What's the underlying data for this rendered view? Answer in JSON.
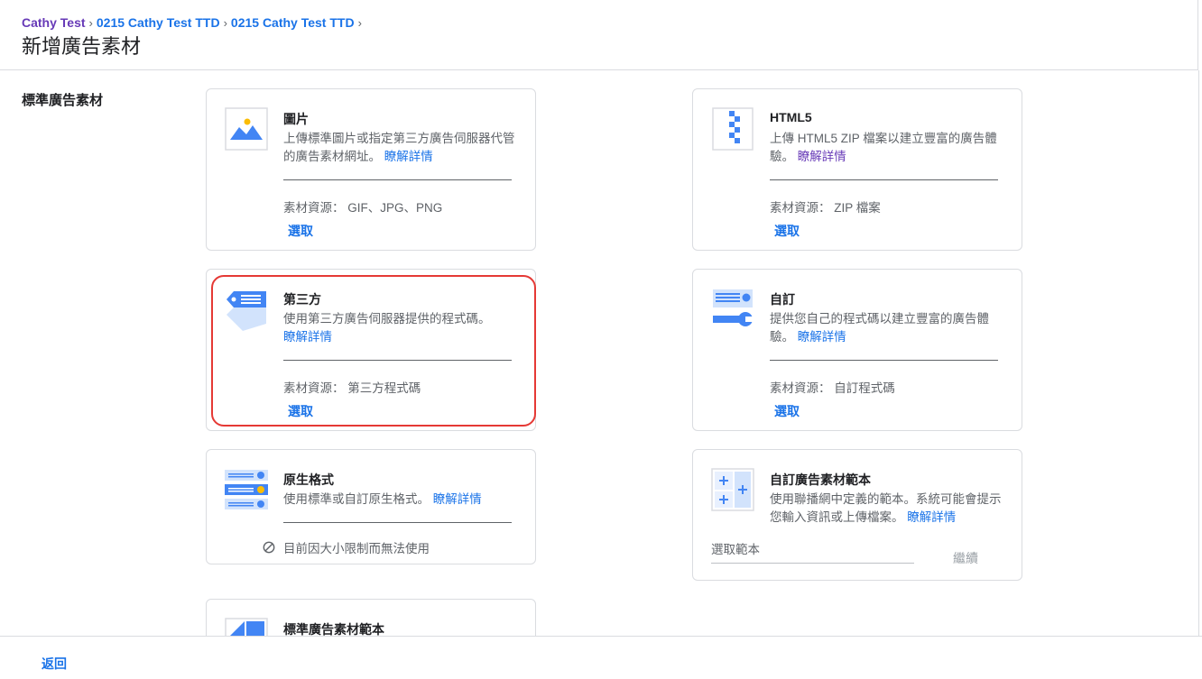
{
  "breadcrumb": {
    "items": [
      "Cathy Test",
      "0215 Cathy Test TTD",
      "0215 Cathy Test TTD"
    ],
    "separator": ">"
  },
  "page_title": "新增廣告素材",
  "section_label": "標準廣告素材",
  "cards": {
    "image": {
      "icon": "image-icon",
      "title": "圖片",
      "desc": "上傳標準圖片或指定第三方廣告伺服器代管的廣告素材網址。",
      "learn_more": "瞭解詳情",
      "source_label": "素材資源：",
      "source_value": "GIF、JPG、PNG",
      "select": "選取"
    },
    "html5": {
      "icon": "zip-file-icon",
      "title": "HTML5",
      "desc": "上傳 HTML5 ZIP 檔案以建立豐富的廣告體驗。",
      "learn_more": "瞭解詳情",
      "source_label": "素材資源：",
      "source_value": "ZIP 檔案",
      "select": "選取"
    },
    "third_party": {
      "icon": "tag-icon",
      "title": "第三方",
      "desc": "使用第三方廣告伺服器提供的程式碼。",
      "learn_more": "瞭解詳情",
      "source_label": "素材資源：",
      "source_value": "第三方程式碼",
      "select": "選取"
    },
    "custom": {
      "icon": "wrench-icon",
      "title": "自訂",
      "desc": "提供您自己的程式碼以建立豐富的廣告體驗。",
      "learn_more": "瞭解詳情",
      "source_label": "素材資源：",
      "source_value": "自訂程式碼",
      "select": "選取"
    },
    "native": {
      "icon": "native-list-icon",
      "title": "原生格式",
      "desc": "使用標準或自訂原生格式。",
      "learn_more": "瞭解詳情",
      "note": "目前因大小限制而無法使用"
    },
    "custom_template": {
      "icon": "template-plus-icon",
      "title": "自訂廣告素材範本",
      "desc": "使用聯播網中定義的範本。系統可能會提示您輸入資訊或上傳檔案。",
      "learn_more": "瞭解詳情",
      "input_placeholder": "選取範本",
      "continue": "繼續"
    },
    "standard_template": {
      "icon": "standard-template-icon",
      "title": "標準廣告素材範本"
    }
  },
  "footer": {
    "back": "返回"
  },
  "colors": {
    "link": "#1a73e8",
    "highlight": "#e53935",
    "icon_blue": "#4285f4",
    "icon_yellow": "#fbbc04"
  }
}
